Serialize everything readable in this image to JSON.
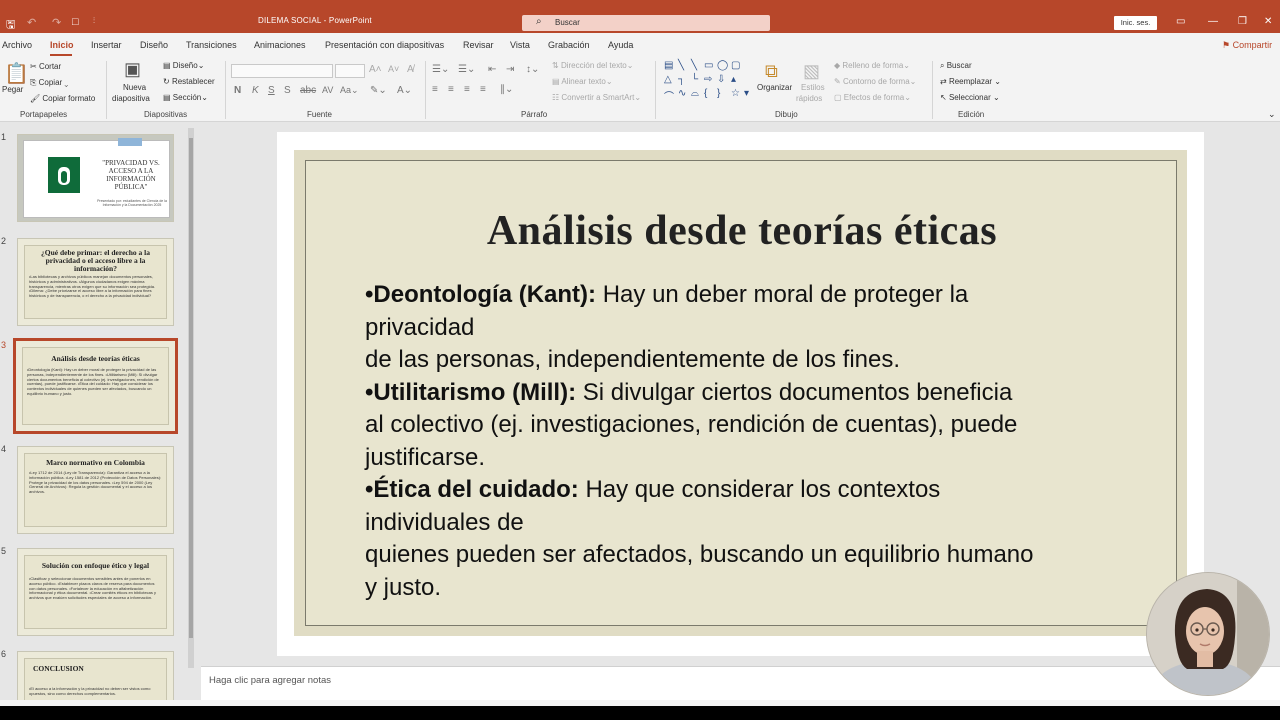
{
  "window": {
    "doc_title": "DILEMA SOCIAL  -  PowerPoint",
    "search_label": "Buscar",
    "signin_label": "Inic. ses."
  },
  "tabs": [
    "Archivo",
    "Inicio",
    "Insertar",
    "Diseño",
    "Transiciones",
    "Animaciones",
    "Presentación con diapositivas",
    "Revisar",
    "Vista",
    "Grabación",
    "Ayuda"
  ],
  "active_tab": "Inicio",
  "share_label": "Compartir",
  "ribbon": {
    "clipboard": {
      "paste": "Pegar",
      "cut": "Cortar",
      "copy": "Copiar",
      "format_painter": "Copiar formato",
      "group": "Portapapeles"
    },
    "slides": {
      "new_slide_line1": "Nueva",
      "new_slide_line2": "diapositiva",
      "layout": "Diseño",
      "reset": "Restablecer",
      "section": "Sección",
      "group": "Diapositivas"
    },
    "font": {
      "group": "Fuente"
    },
    "paragraph": {
      "text_direction": "Dirección del texto",
      "align_text": "Alinear texto",
      "smartart": "Convertir a SmartArt",
      "group": "Párrafo"
    },
    "drawing": {
      "arrange": "Organizar",
      "quick_styles_line1": "Estilos",
      "quick_styles_line2": "rápidos",
      "shape_fill": "Relleno de forma",
      "shape_outline": "Contorno de forma",
      "shape_effects": "Efectos de forma",
      "group": "Dibujo"
    },
    "editing": {
      "find": "Buscar",
      "replace": "Reemplazar",
      "select": "Seleccionar",
      "group": "Edición"
    }
  },
  "thumbnails": [
    {
      "num": "1",
      "title": "\"PRIVACIDAD VS. ACCESO A LA INFORMACIÓN PÚBLICA\"",
      "logo_text": "UNIVERSIDAD DEL QUINDÍO",
      "subtitle": "Presentado por: estudiantes de Ciencia de la Información y la Documentación 2025"
    },
    {
      "num": "2",
      "title": "¿Qué debe primar: el derecho a la privacidad o el acceso libre a la información?",
      "body": "•Las bibliotecas y archivos públicos manejan documentos personales, históricos y administrativos. •Algunos ciudadanos exigen máxima transparencia, mientras otros exigen que su información sea protegida. •Dilema: ¿Debe priorizarse el acceso libre a la información para fines históricos y de transparencia, o el derecho a la privacidad individual?"
    },
    {
      "num": "3",
      "title": "Análisis desde teorías éticas",
      "body": "•Deontología (Kant): Hay un deber moral de proteger la privacidad de las personas, independientemente de los fines. •Utilitarismo (Mill): Si divulgar ciertos documentos beneficia al colectivo (ej. investigaciones, rendición de cuentas), puede justificarse. •Ética del cuidado: Hay que considerar los contextos individuales de quienes pueden ser afectados, buscando un equilibrio humano y justo."
    },
    {
      "num": "4",
      "title": "Marco normativo en Colombia",
      "body": "•Ley 1712 de 2014 (Ley de Transparencia): Garantiza el acceso a la información pública. •Ley 1581 de 2012 (Protección de Datos Personales): Protege la privacidad de los datos personales. •Ley 594 de 2000 (Ley General de Archivos): Regula la gestión documental y el acceso a los archivos."
    },
    {
      "num": "5",
      "title": "Solución con enfoque ético y legal",
      "body": "•Clasificar y seleccionar documentos sensibles antes de ponerlos en acceso público. •Establecer plazos claros de reserva para documentos con datos personales. •Fortalecer la educación en alfabetización informacional y ética documental. •Crear comités éticos en bibliotecas y archivos que evalúen solicitudes especiales de acceso a información."
    },
    {
      "num": "6",
      "title": "CONCLUSION",
      "body": "•El acceso a la información y la privacidad no deben ser vistos como opuestos, sino como derechos complementarios."
    }
  ],
  "slide": {
    "title": "Análisis desde teorías éticas",
    "lines": [
      {
        "bold": "•Deontología (Kant):",
        "text": " Hay un deber moral de proteger la"
      },
      {
        "bold": "",
        "text": "privacidad"
      },
      {
        "bold": "",
        "text": " de las personas, independientemente de los fines."
      },
      {
        "bold": "•Utilitarismo (Mill):",
        "text": " Si divulgar ciertos documentos beneficia"
      },
      {
        "bold": "",
        "text": " al colectivo (ej. investigaciones, rendición de cuentas), puede"
      },
      {
        "bold": "",
        "text": "justificarse."
      },
      {
        "bold": "•Ética del cuidado:",
        "text": " Hay que considerar los contextos"
      },
      {
        "bold": "",
        "text": "individuales de"
      },
      {
        "bold": "",
        "text": "quienes pueden ser afectados, buscando un equilibrio humano"
      },
      {
        "bold": "",
        "text": "y justo."
      }
    ]
  },
  "notes_placeholder": "Haga clic para agregar notas",
  "colors": {
    "accent": "#b7472a",
    "slide_bg": "#e8e5cf",
    "selection": "#b7472a"
  }
}
